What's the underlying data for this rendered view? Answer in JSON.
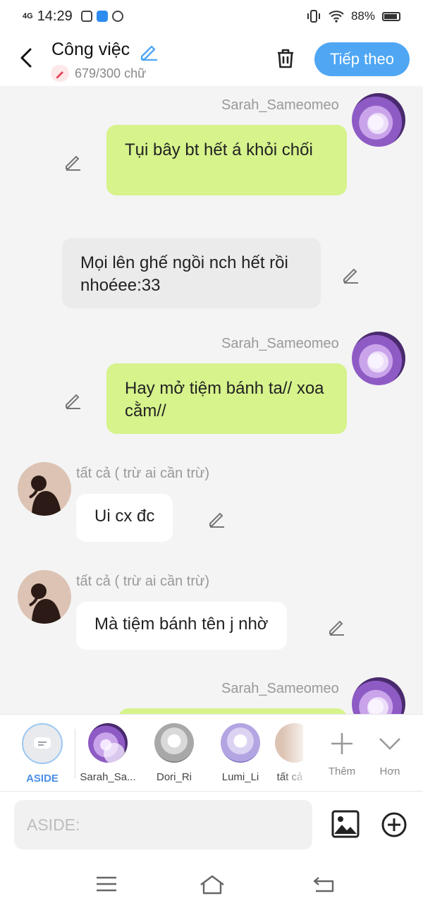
{
  "status": {
    "network": "4G",
    "time": "14:29",
    "battery": "88%"
  },
  "header": {
    "title": "Công việc",
    "word_count": "679/300 chữ",
    "next_label": "Tiếp theo"
  },
  "messages": [
    {
      "sender": "Sarah_Sameomeo",
      "text": "Tụi bây bt hết á khỏi chối",
      "side": "right",
      "style": "green"
    },
    {
      "sender": "",
      "text": "Mọi lên ghế ngồi nch hết rồi nhoéee:33",
      "side": "left",
      "style": "gray"
    },
    {
      "sender": "Sarah_Sameomeo",
      "text": "Hay mở tiệm bánh ta// xoa cằm//",
      "side": "right",
      "style": "green"
    },
    {
      "sender": "tất cả ( trừ ai cần trừ)",
      "text": "Ui cx đc",
      "side": "left",
      "style": "white"
    },
    {
      "sender": "tất cả ( trừ ai cần trừ)",
      "text": "Mà tiệm bánh tên j nhờ",
      "side": "left",
      "style": "white"
    },
    {
      "sender": "Sarah_Sameomeo",
      "text": "",
      "side": "right",
      "style": "green"
    }
  ],
  "participants": [
    {
      "label": "ASIDE"
    },
    {
      "label": "Sarah_Sa..."
    },
    {
      "label": "Dori_Ri"
    },
    {
      "label": "Lumi_Li"
    },
    {
      "label": "tất cả"
    }
  ],
  "actions": {
    "add_label": "Thêm",
    "more_label": "Hơn"
  },
  "composer": {
    "placeholder": "ASIDE:"
  },
  "colors": {
    "accent": "#4fa7f3",
    "bubble_green": "#d6f38c",
    "bubble_gray": "#ebebeb"
  }
}
